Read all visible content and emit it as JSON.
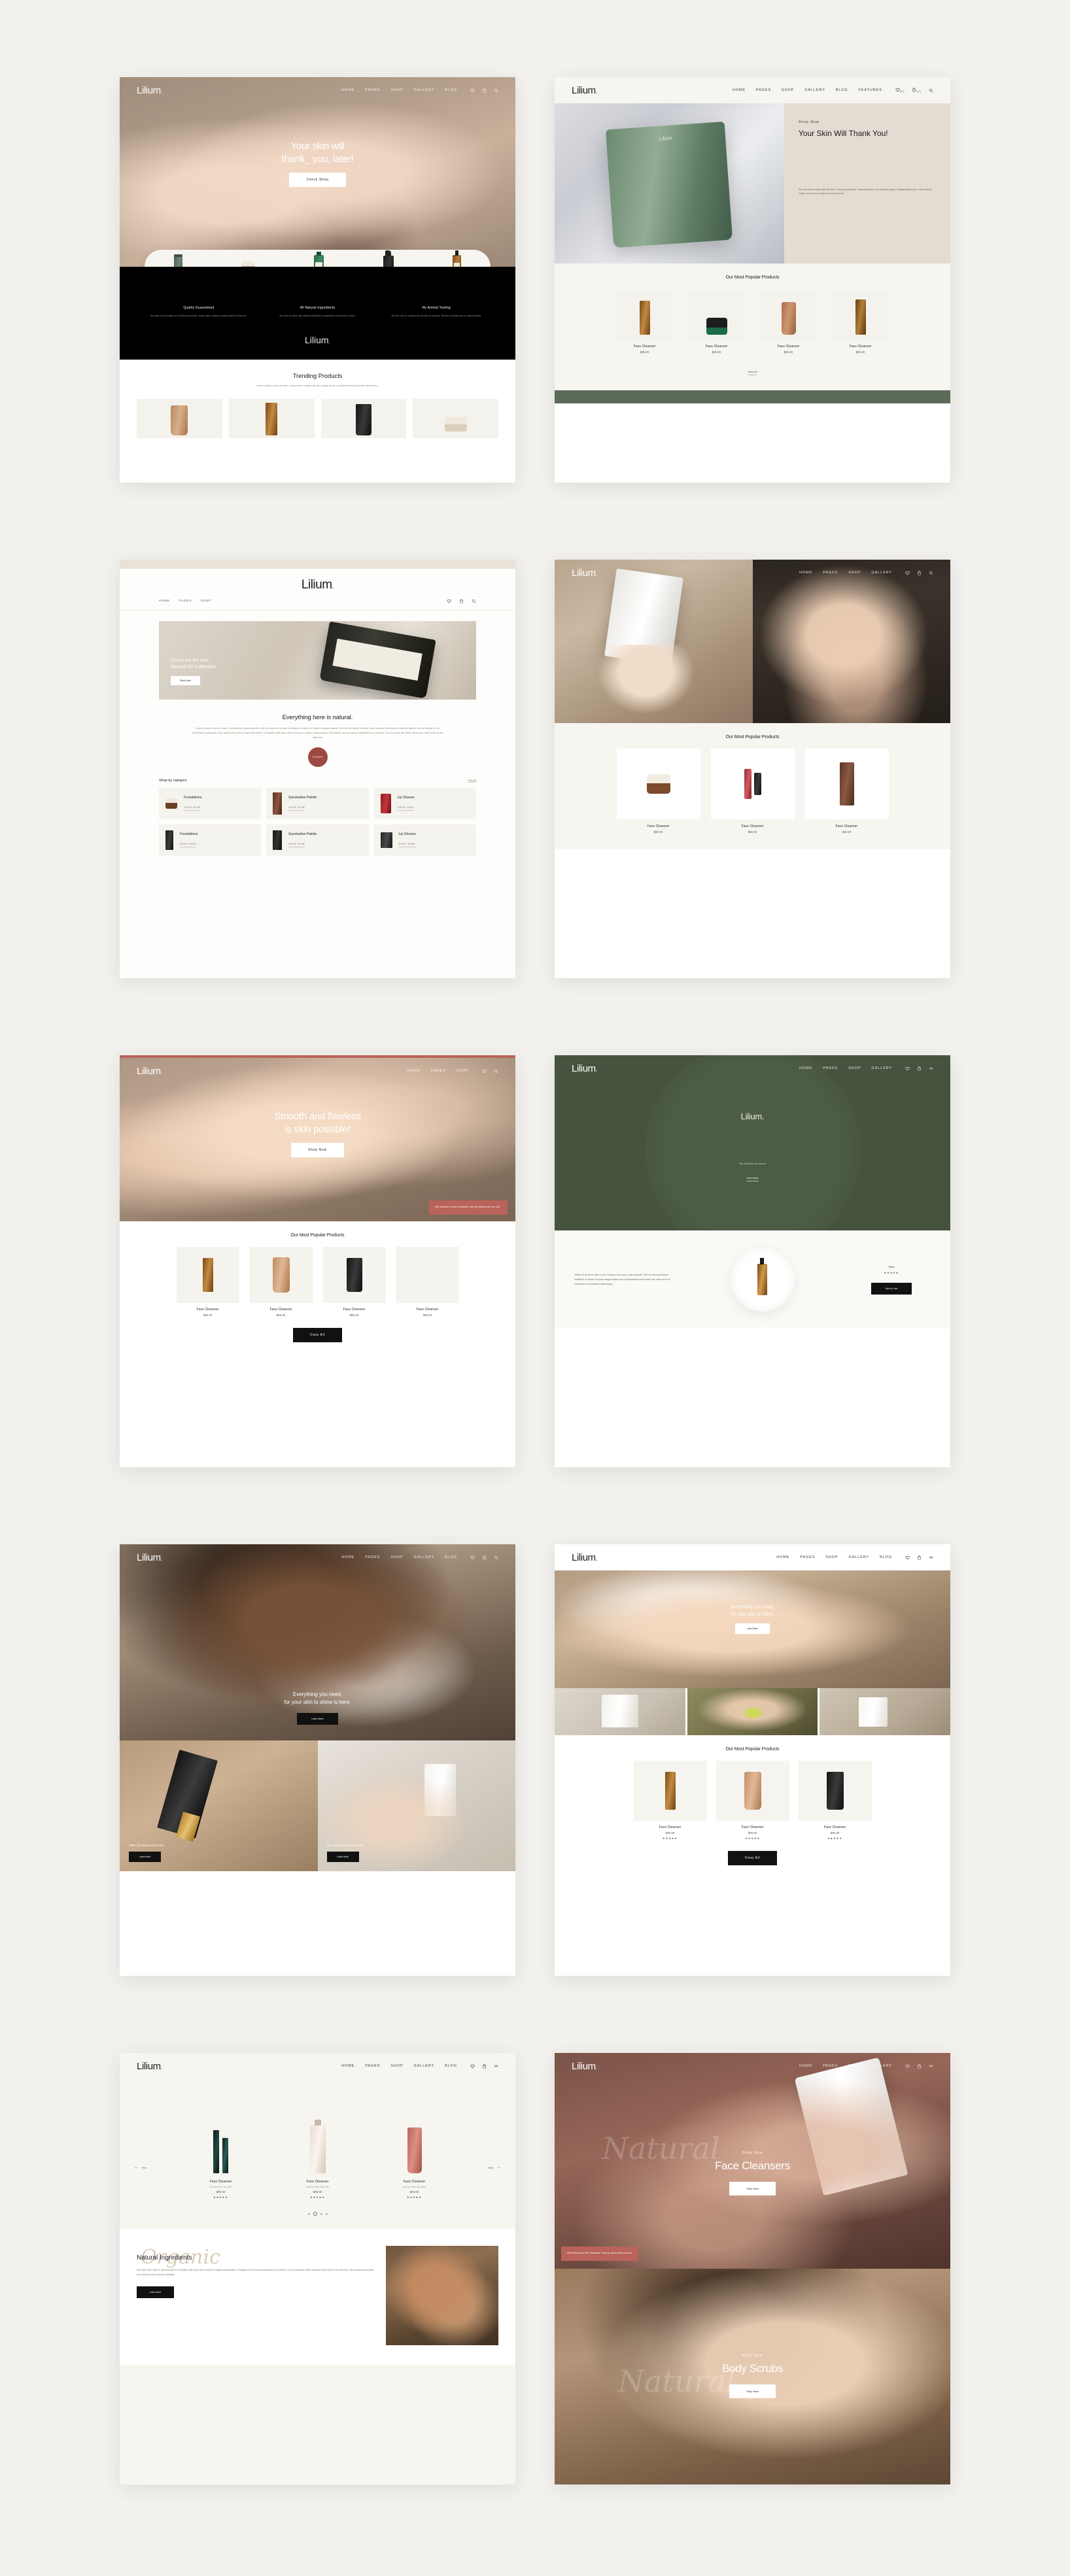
{
  "brand": {
    "name": "Lilium",
    "dot": "."
  },
  "nav": {
    "links": [
      "HOME",
      "PAGES",
      "SHOP",
      "GALLERY",
      "BLOG",
      "FEATURES"
    ],
    "links_short": [
      "HOME",
      "PAGES",
      "SHOP",
      "GALLERY",
      "BLOG"
    ],
    "links_min": [
      "HOME",
      "PAGES",
      "SHOP"
    ],
    "wishlist_count": "(0)",
    "cart_count": "(0)",
    "icons": {
      "heart": "heart-icon",
      "bag": "bag-icon",
      "search": "search-icon",
      "menu": "menu-icon"
    }
  },
  "lorem": {
    "short": "Lorem ipsum dolor sit amet, consectetur adipiscing elit. Augue quam volutpat suscipit pulvinar vel fermen.",
    "para": "Lorem ipsum dolor sit amet, consectetur adipiscing elit, sed do eiusmod tempor incididunt ut labore et dolore magna aliqua. Ut enim ad minim veniam, quis nostrud exercitation ullamco laboris nisi ut aliquip ex ea commodo consequat. Duis aute irure dolor in reprehenderit in voluptate velit esse cillum dolore eu fugiat nulla pariatur. Excepteur sint occaecat cupidatat non proident, sunt in culpa qui officia deserunt mollit anim id est laborum.",
    "body": "Duis aute irure dolor in reprehenderit in voluptate velit esse cillum dolore eu fugiat nulla pariatur. Excepteur sint occaecat cupidatat non proident, sunt in culpa qui officia deserunt mollit anim id est laborum. Sint occaecat cupidatat non proident sint occaecat cupidatat."
  },
  "demo1": {
    "hero_title_l1": "Your skin will",
    "hero_title_l2": "thank_ you, later!",
    "hero_btn": "Check Shop",
    "features": [
      {
        "title": "Quality Guaranteed",
        "desc": "We stand by the quality of our finished products. Augue quam volutpat suscipit pulvinar vel fermen."
      },
      {
        "title": "All Natural Ingredients",
        "desc": "We strive to utilize only natural ingredients or ingredients derived from nature."
      },
      {
        "title": "No Animal Testing",
        "desc": "We don't test on animals and we care for animals. We are for beauty with no animal testing."
      }
    ],
    "section_title": "Trending Products",
    "products": [
      "tube-green",
      "jar-amber",
      "pump-black",
      "jar-cream"
    ]
  },
  "demo2": {
    "eyebrow": "Shop Now",
    "title": "Your Skin Will Thank You!",
    "body": "Sed quis libero atque velit nisi diam. Natoque parturient. Massa tincidunt nunc pulvinar sapien et ligula ullamcorper. Nisl rhoncus mattis rhoncus urna neque viverra justo nec.",
    "section_title": "Our Most Popular Products",
    "view_all": "View All",
    "products": [
      {
        "name": "Face Cleanser",
        "price": "$80.00",
        "img": "amber-bottle"
      },
      {
        "name": "Face Cleanser",
        "price": "$80.00",
        "img": "black-jar"
      },
      {
        "name": "Face Cleanser",
        "price": "$80.00",
        "img": "clay-tube"
      },
      {
        "name": "Face Cleanser",
        "price": "$80.00",
        "img": "amber-dropper"
      }
    ]
  },
  "demo3": {
    "hero_title_l1": "Check out the new",
    "hero_title_l2": "Almond Oil Collection!",
    "hero_btn": "Shop Now",
    "section_title": "Everything here is natural.",
    "badge": "VEGAN",
    "cat_heading": "Shop by category",
    "cat_all": "View All",
    "shop_now": "SHOP NOW",
    "categories": [
      "Foundations",
      "Eyeshadow Palette",
      "Lip Glosses",
      "Foundations",
      "Eyeshadow Palette",
      "Lip Glosses"
    ]
  },
  "demo4": {
    "section_title": "Our Most Popular Products",
    "products": [
      {
        "name": "Face Cleanser",
        "price": "$80.00"
      },
      {
        "name": "Face Cleanser",
        "price": "$80.00"
      },
      {
        "name": "Face Cleanser",
        "price": "$80.00"
      }
    ]
  },
  "demo5": {
    "hero_title_l1": "Smooth and flawless",
    "hero_title_l2": "is skin possible!",
    "hero_btn": "Shop Now",
    "promo": "50% Discount on Face Treatment. Hurry up, Before time runs out!",
    "section_title": "Our Most Popular Products",
    "view_all": "View All",
    "products": [
      {
        "name": "Face Cleanser",
        "price": "$80.00"
      },
      {
        "name": "Face Cleanser",
        "price": "$80.00"
      },
      {
        "name": "Face Cleanser",
        "price": "$80.00"
      },
      {
        "name": "Face Cleanser",
        "price": "$80.00"
      }
    ]
  },
  "demo6": {
    "hero_brand": "Lilium.",
    "hero_sub": "We will save our theme",
    "hero_btn": "Learn More",
    "body_title": "Vitamin E",
    "body": "Vitamin E lid sit for sale ut sed. Facere ut ea minim, quis volutpat? Sed do eiusmod tempor incididunt ut labore et dolore magna aliqua sed ut perspiciatis unde omnis iste natus error sit voluptatem accusantium doloremque.",
    "price_label": "Price",
    "price": "$80.00",
    "btn": "Add to Cart"
  },
  "demo7": {
    "title_l1": "Everything you need,",
    "title_l2": "for your skin to shine is here.",
    "btn": "Learn More",
    "tile1": "100% All Natural Face Oils.",
    "tile2": "See what's best for you skin.",
    "tile_btn": "Learn More"
  },
  "demo8": {
    "title_l1": "Everything you need,",
    "title_l2": "for your skin to shine.",
    "btn": "Learn More",
    "section_title": "Our Most Popular Products",
    "view_all": "View All",
    "products": [
      {
        "name": "Face Cleanser",
        "price": "$80.00"
      },
      {
        "name": "Face Cleanser",
        "price": "$80.00"
      },
      {
        "name": "Face Cleanser",
        "price": "$80.00"
      }
    ]
  },
  "demo9": {
    "products": [
      {
        "name": "Face Cleanser",
        "meta": "Normal Skin, Dry Skin",
        "price": "$80.00",
        "stars": "★★★★★"
      },
      {
        "name": "Face Cleanser",
        "meta": "Normal Skin, Dry Skin",
        "price": "$80.00",
        "stars": "★★★★★"
      },
      {
        "name": "Face Cleanser",
        "meta": "Normal Skin, Dry Skin",
        "price": "$80.00",
        "stars": "★★★★★"
      }
    ],
    "script_word": "Organic",
    "title": "Natural Ingredients",
    "btn": "Learn More"
  },
  "demo10": {
    "promo": "50% Discount on Face Treatment. Hurry up, Before time runs out!",
    "block1": {
      "eyebrow": "Shop Now",
      "title": "Face Cleansers",
      "btn": "Shop Now",
      "script": "Natural"
    },
    "block2": {
      "eyebrow": "Shop Now",
      "title": "Body Scrubs",
      "btn": "Shop Now",
      "script": "Natural"
    }
  }
}
